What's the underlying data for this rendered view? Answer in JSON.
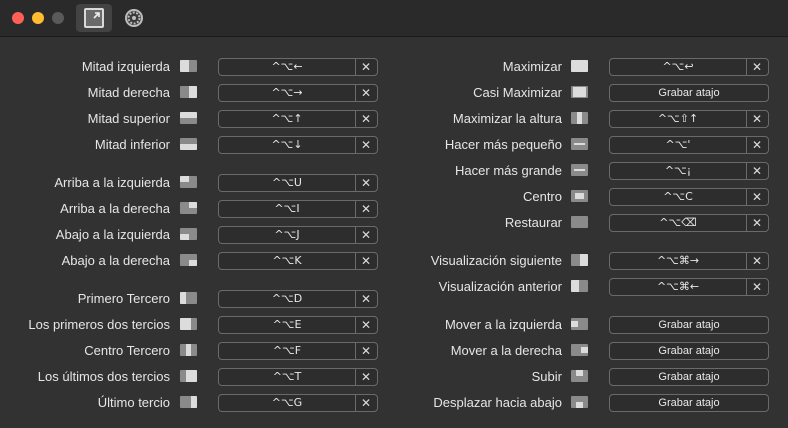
{
  "window": {
    "toolbar": {
      "tabs": [
        "shortcuts-icon",
        "gear-icon"
      ]
    }
  },
  "shortcuts": {
    "left": [
      {
        "label": "Mitad izquierda",
        "shortcut": "^⌥←",
        "icon": "half-left-icon"
      },
      {
        "label": "Mitad derecha",
        "shortcut": "^⌥→",
        "icon": "half-right-icon"
      },
      {
        "label": "Mitad superior",
        "shortcut": "^⌥↑",
        "icon": "half-top-icon"
      },
      {
        "label": "Mitad inferior",
        "shortcut": "^⌥↓",
        "icon": "half-bottom-icon"
      },
      {
        "label": "Arriba a la izquierda",
        "shortcut": "^⌥U",
        "icon": "top-left-icon"
      },
      {
        "label": "Arriba a la derecha",
        "shortcut": "^⌥I",
        "icon": "top-right-icon"
      },
      {
        "label": "Abajo a la izquierda",
        "shortcut": "^⌥J",
        "icon": "bottom-left-icon"
      },
      {
        "label": "Abajo a la derecha",
        "shortcut": "^⌥K",
        "icon": "bottom-right-icon"
      },
      {
        "label": "Primero Tercero",
        "shortcut": "^⌥D",
        "icon": "first-third-icon"
      },
      {
        "label": "Los primeros dos tercios",
        "shortcut": "^⌥E",
        "icon": "first-two-thirds-icon"
      },
      {
        "label": "Centro Tercero",
        "shortcut": "^⌥F",
        "icon": "center-third-icon"
      },
      {
        "label": "Los últimos dos tercios",
        "shortcut": "^⌥T",
        "icon": "last-two-thirds-icon"
      },
      {
        "label": "Último tercio",
        "shortcut": "^⌥G",
        "icon": "last-third-icon"
      }
    ],
    "right": [
      {
        "label": "Maximizar",
        "shortcut": "^⌥↩",
        "icon": "maximize-icon"
      },
      {
        "label": "Casi Maximizar",
        "record": "Grabar atajo",
        "icon": "almost-maximize-icon"
      },
      {
        "label": "Maximizar la altura",
        "shortcut": "^⌥⇧↑",
        "icon": "maximize-height-icon"
      },
      {
        "label": "Hacer más pequeño",
        "shortcut": "^⌥'",
        "icon": "smaller-icon"
      },
      {
        "label": "Hacer más grande",
        "shortcut": "^⌥¡",
        "icon": "larger-icon"
      },
      {
        "label": "Centro",
        "shortcut": "^⌥C",
        "icon": "center-icon"
      },
      {
        "label": "Restaurar",
        "shortcut": "^⌥⌫",
        "icon": "restore-icon"
      },
      {
        "label": "Visualización siguiente",
        "shortcut": "^⌥⌘→",
        "icon": "next-display-icon"
      },
      {
        "label": "Visualización anterior",
        "shortcut": "^⌥⌘←",
        "icon": "previous-display-icon"
      },
      {
        "label": "Mover a la izquierda",
        "record": "Grabar atajo",
        "icon": "move-left-icon"
      },
      {
        "label": "Mover a la derecha",
        "record": "Grabar atajo",
        "icon": "move-right-icon"
      },
      {
        "label": "Subir",
        "record": "Grabar atajo",
        "icon": "move-up-icon"
      },
      {
        "label": "Desplazar hacia abajo",
        "record": "Grabar atajo",
        "icon": "move-down-icon"
      }
    ],
    "clear_glyph": "✕"
  }
}
